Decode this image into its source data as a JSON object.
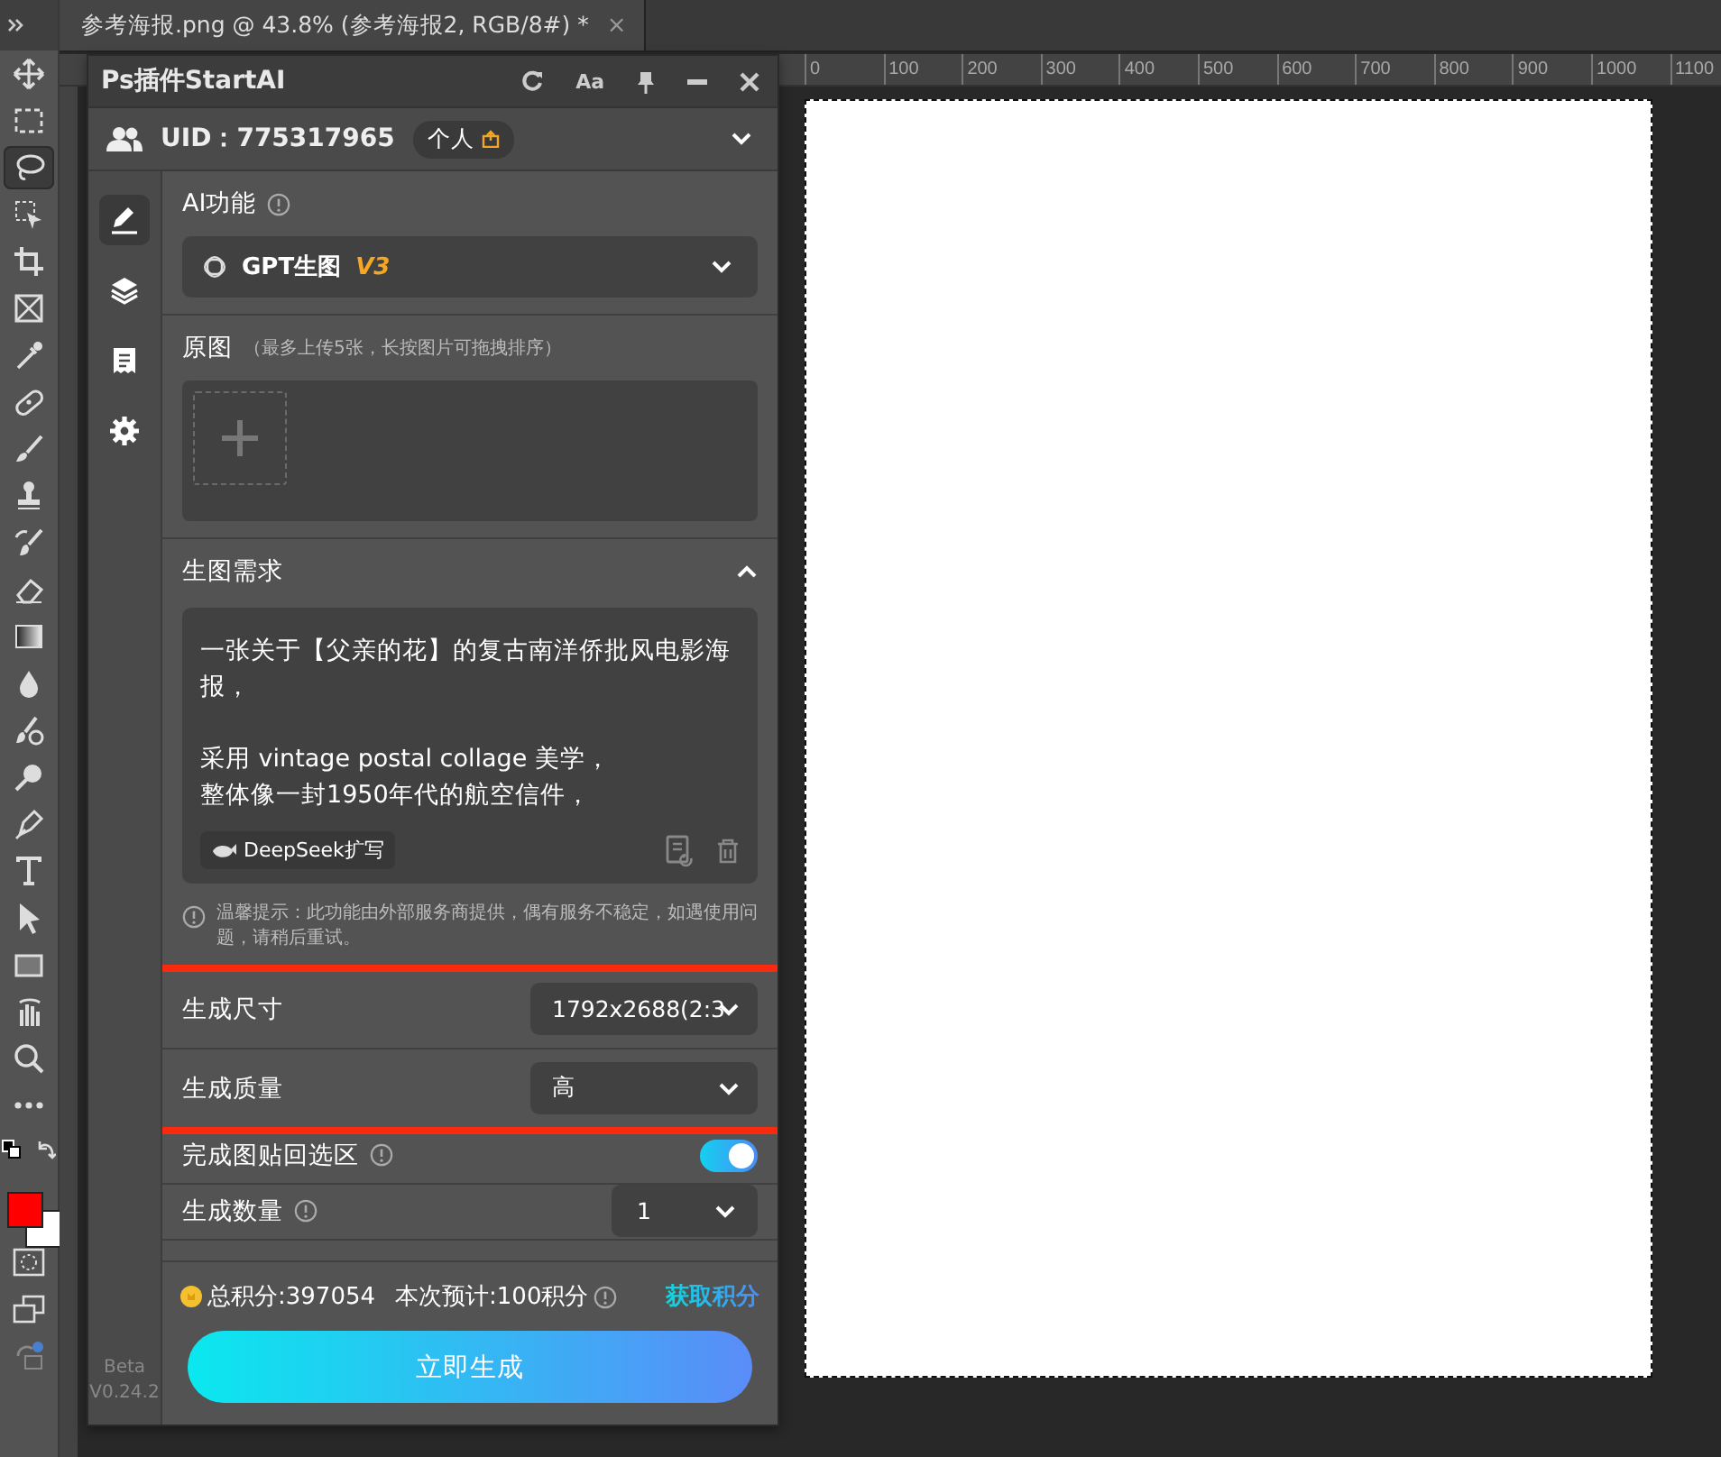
{
  "document_tab": {
    "title": "参考海报.png @ 43.8% (参考海报2, RGB/8#) *",
    "close": "×"
  },
  "tools": [
    {
      "selected": false
    },
    {
      "selected": false
    },
    {
      "selected": true
    },
    {
      "selected": false
    },
    {
      "selected": false
    },
    {
      "selected": false
    },
    {
      "selected": false
    },
    {
      "selected": false
    },
    {
      "selected": false
    },
    {
      "selected": false
    },
    {
      "selected": false
    },
    {
      "selected": false
    },
    {
      "selected": false
    },
    {
      "selected": false
    },
    {
      "selected": false
    },
    {
      "selected": false
    },
    {
      "selected": false
    },
    {
      "selected": false
    },
    {
      "selected": false
    },
    {
      "selected": false
    },
    {
      "selected": false
    },
    {
      "selected": false
    },
    {
      "selected": false
    }
  ],
  "swatches": [
    {
      "color": "#ff0000"
    },
    {
      "color": "#ffffff"
    }
  ],
  "ruler": {
    "labels": [
      "0",
      "100",
      "200",
      "300",
      "400",
      "500",
      "600",
      "700",
      "800",
      "900",
      "1000",
      "1100"
    ]
  },
  "plugin": {
    "title": "Ps插件StartAI",
    "font_button": "Aa",
    "uid": "UID：775317965",
    "account_badge": "个人",
    "nav": [
      {
        "selected": true
      },
      {
        "selected": false
      },
      {
        "selected": false
      },
      {
        "selected": false
      }
    ],
    "version": [
      "Beta",
      "V0.24.2"
    ],
    "ai_function": {
      "label": "AI功能",
      "value": "GPT生图",
      "tag": "V3"
    },
    "source_images": {
      "label": "原图",
      "hint": "（最多上传5张，长按图片可拖拽排序）"
    },
    "prompt": {
      "label": "生图需求",
      "expanded": true,
      "paragraphs": [
        [
          "一张关于【父亲的花】的复古南洋侨批风电影海报，"
        ],
        [
          "采用 vintage postal collage 美学，",
          "整体像一封1950年代的航空信件，"
        ]
      ],
      "expand_button": "DeepSeek扩写",
      "tip": "温馨提示：此功能由外部服务商提供，偶有服务不稳定，如遇使用问题，请稍后重试。"
    },
    "settings": [
      {
        "kind": "select",
        "label": "生成尺寸",
        "value": "1792x2688(2:3",
        "info": false,
        "highlighted": true
      },
      {
        "kind": "select",
        "label": "生成质量",
        "value": "高",
        "info": false,
        "highlighted": true
      },
      {
        "kind": "toggle",
        "label": "完成图贴回选区",
        "info": true,
        "on": true,
        "highlighted": false
      },
      {
        "kind": "select",
        "label": "生成数量",
        "value": "1",
        "info": true,
        "highlighted": false
      },
      {
        "kind": "cut"
      }
    ],
    "points": {
      "total": "总积分:397054",
      "estimate": "本次预计:100积分",
      "link": "获取积分"
    },
    "generate_button": "立即生成"
  }
}
